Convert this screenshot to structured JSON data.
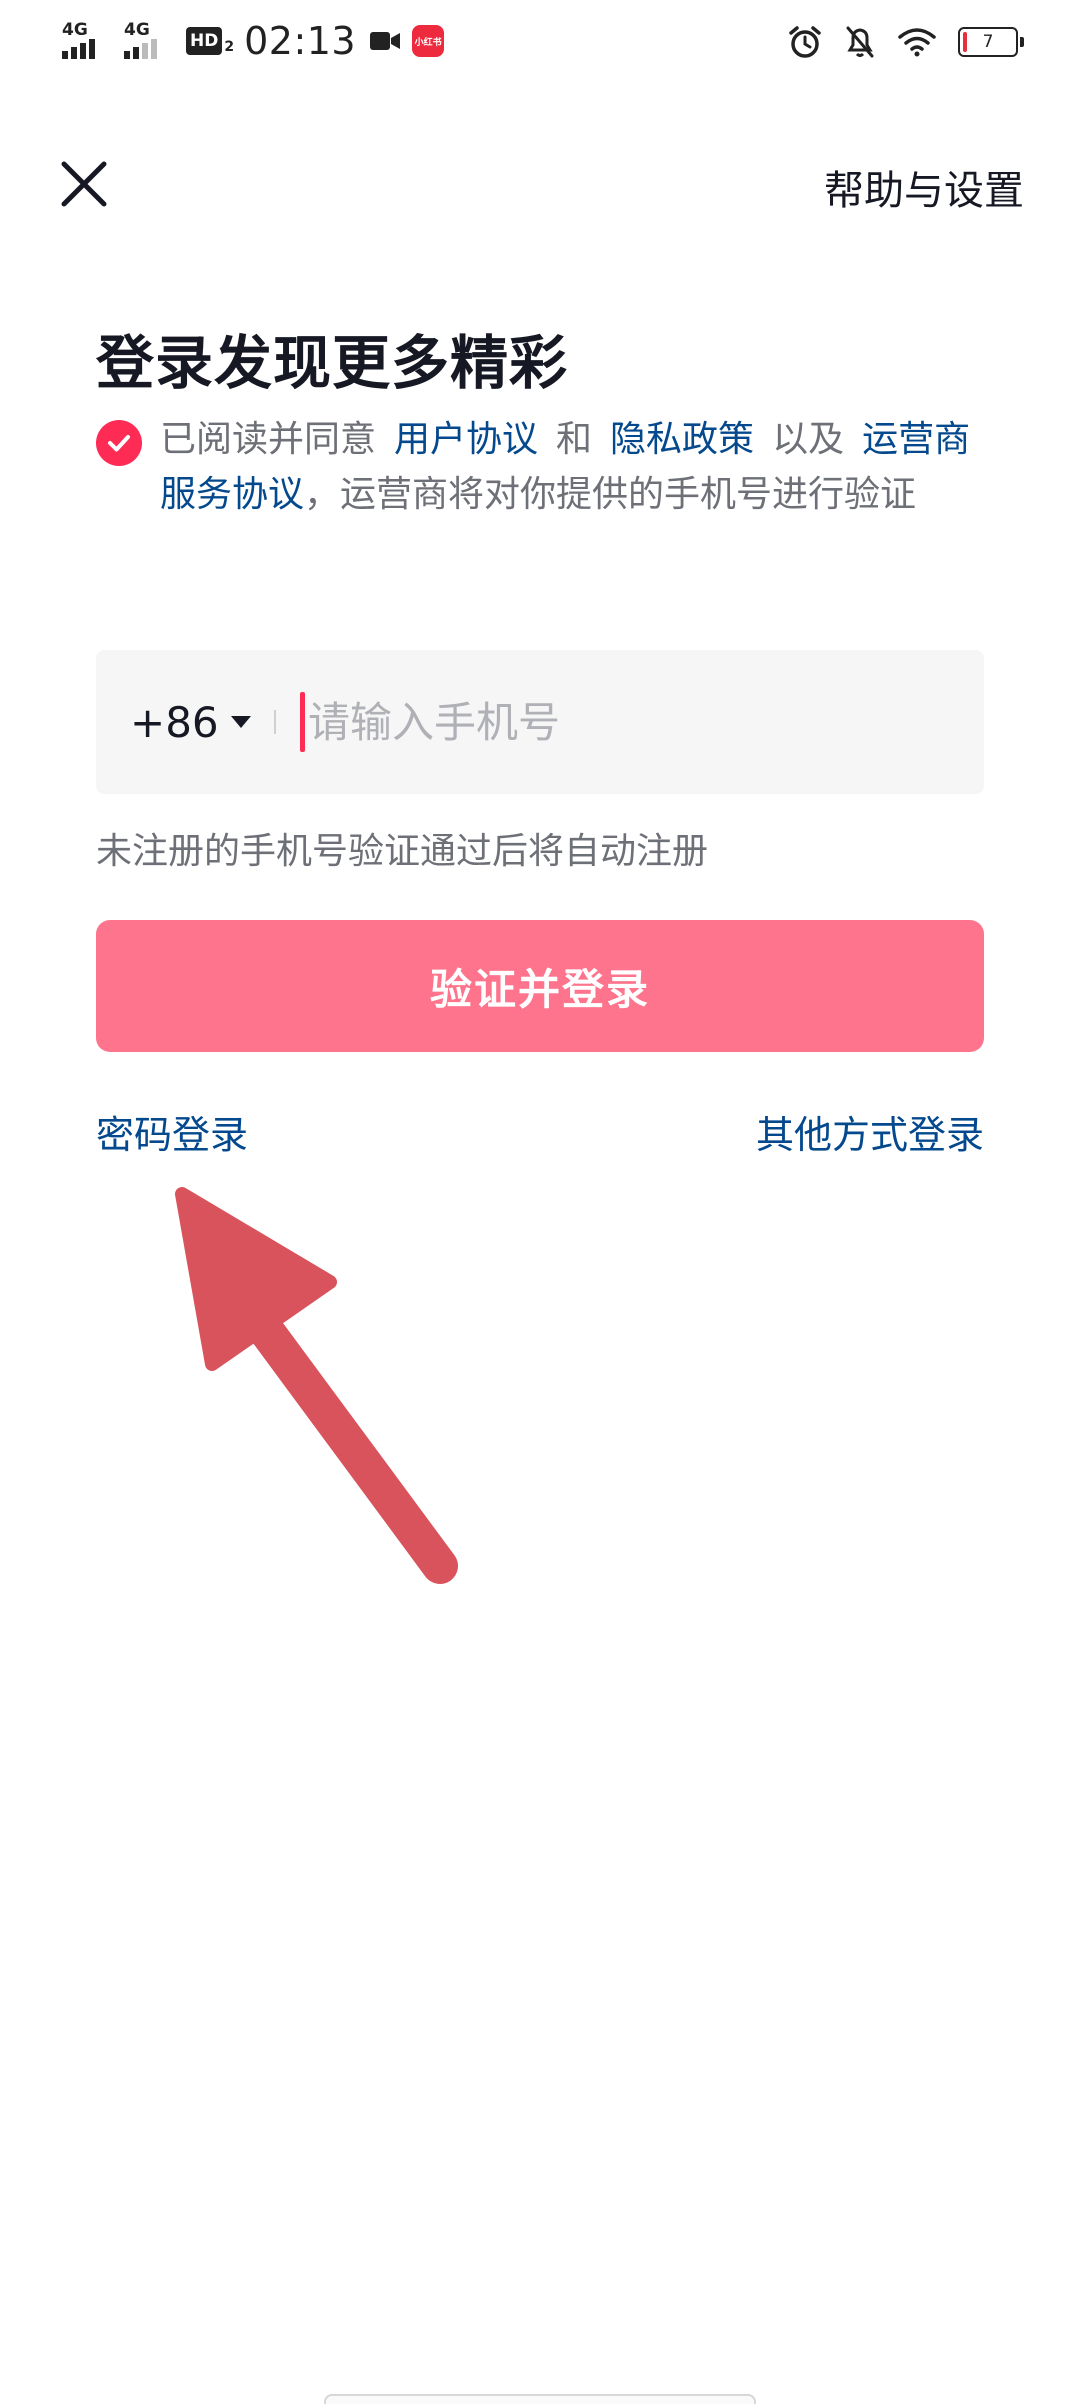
{
  "status_bar": {
    "network_1": "4G",
    "network_2": "4G",
    "hd_label": "HD",
    "hd_sub": "2",
    "time": "02:13",
    "app_badge_text": "小红书",
    "battery_level": "7",
    "icons": [
      "signal-icon",
      "hd-icon",
      "video-icon",
      "app-badge-icon",
      "alarm-icon",
      "mute-bell-icon",
      "wifi-icon",
      "battery-icon"
    ]
  },
  "header": {
    "close_icon": "close-icon",
    "help_label": "帮助与设置"
  },
  "title": "登录发现更多精彩",
  "agreement": {
    "checked": true,
    "prefix": "已阅读并同意",
    "user_agreement": "用户协议",
    "and": "和",
    "privacy_policy": "隐私政策",
    "also": "以及",
    "carrier_agreement": "运营商服务协议",
    "comma": "，",
    "suffix": "运营商将对你提供的手机号进行验证"
  },
  "phone": {
    "country_code": "+86",
    "value": "",
    "placeholder": "请输入手机号"
  },
  "hint": "未注册的手机号验证通过后将自动注册",
  "login_button": "验证并登录",
  "password_login": "密码登录",
  "other_login": "其他方式登录",
  "colors": {
    "accent": "#fe2c55",
    "button": "#fe748c",
    "link": "#04498d",
    "arrow": "#d9535d",
    "input_bg": "#f6f6f6"
  }
}
